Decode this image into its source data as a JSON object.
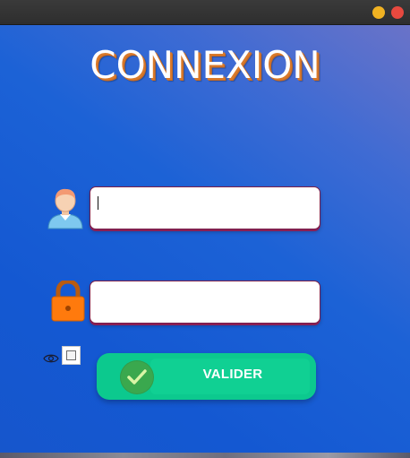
{
  "window": {
    "controls": {
      "minimize_color": "#f0b222",
      "close_color": "#e8493f"
    }
  },
  "login": {
    "title": "CONNEXION",
    "username_field": {
      "value": "",
      "placeholder": ""
    },
    "password_field": {
      "value": "",
      "placeholder": ""
    },
    "show_password": {
      "checked": false,
      "icon": "eye-icon"
    },
    "submit": {
      "label": "VALIDER",
      "icon": "check-icon"
    },
    "icons": {
      "user": "user-icon",
      "password": "lock-icon"
    }
  },
  "colors": {
    "accent_orange": "#d97a2b",
    "button_green": "#0cc98e",
    "field_border": "#7b1f4a",
    "background_blue": "#1458d2"
  }
}
